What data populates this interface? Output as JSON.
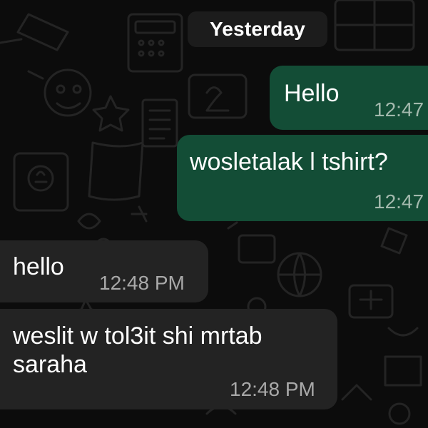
{
  "conversation": {
    "date_separator": "Yesterday",
    "messages": [
      {
        "direction": "outgoing",
        "text": "Hello",
        "time": "12:47"
      },
      {
        "direction": "outgoing",
        "text": "wosletalak l tshirt?",
        "time": "12:47"
      },
      {
        "direction": "incoming",
        "text": "hello",
        "time": "12:48 PM"
      },
      {
        "direction": "incoming",
        "text": "weslit w tol3it shi mrtab\nsaraha",
        "time": "12:48 PM"
      }
    ]
  },
  "colors": {
    "background": "#0c0c0c",
    "outgoing_bubble": "#134d36",
    "incoming_bubble": "#232323",
    "date_chip": "#1c1c1c",
    "text": "#ffffff",
    "timestamp": "#a9a9a9"
  }
}
